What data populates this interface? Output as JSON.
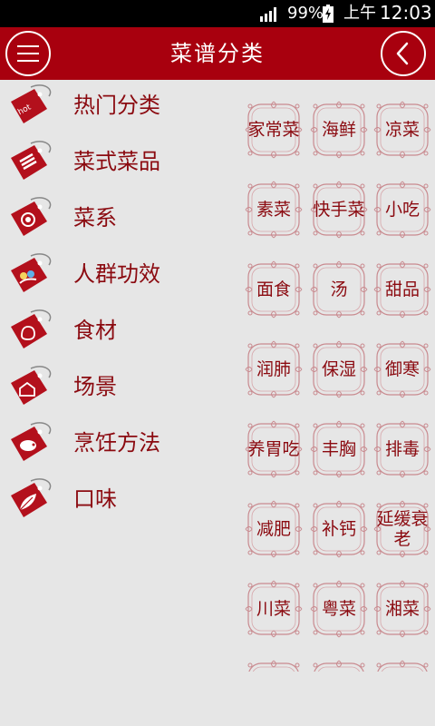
{
  "status_bar": {
    "battery_percent": "99%",
    "ampm": "上午",
    "time": "12:03"
  },
  "header": {
    "title": "菜谱分类",
    "menu_icon": "hamburger-menu-icon",
    "back_icon": "chevron-left-icon"
  },
  "categories": [
    {
      "label": "热门分类",
      "icon": "hot-tag-icon"
    },
    {
      "label": "菜式菜品",
      "icon": "list-tag-icon"
    },
    {
      "label": "菜系",
      "icon": "target-tag-icon"
    },
    {
      "label": "人群功效",
      "icon": "people-tag-icon"
    },
    {
      "label": "食材",
      "icon": "ingredient-tag-icon"
    },
    {
      "label": "场景",
      "icon": "scene-tag-icon"
    },
    {
      "label": "烹饪方法",
      "icon": "pig-tag-icon"
    },
    {
      "label": "口味",
      "icon": "leaf-tag-icon"
    }
  ],
  "tags": [
    [
      "家常菜",
      "海鲜",
      "凉菜"
    ],
    [
      "素菜",
      "快手菜",
      "小吃"
    ],
    [
      "面食",
      "汤",
      "甜品"
    ],
    [
      "润肺",
      "保湿",
      "御寒"
    ],
    [
      "养胃吃",
      "丰胸",
      "排毒"
    ],
    [
      "减肥",
      "补钙",
      "延缓衰老"
    ],
    [
      "川菜",
      "粤菜",
      "湘菜"
    ]
  ],
  "colors": {
    "accent": "#a8000e",
    "text": "#8b0a10",
    "background": "#e6e6e6"
  }
}
